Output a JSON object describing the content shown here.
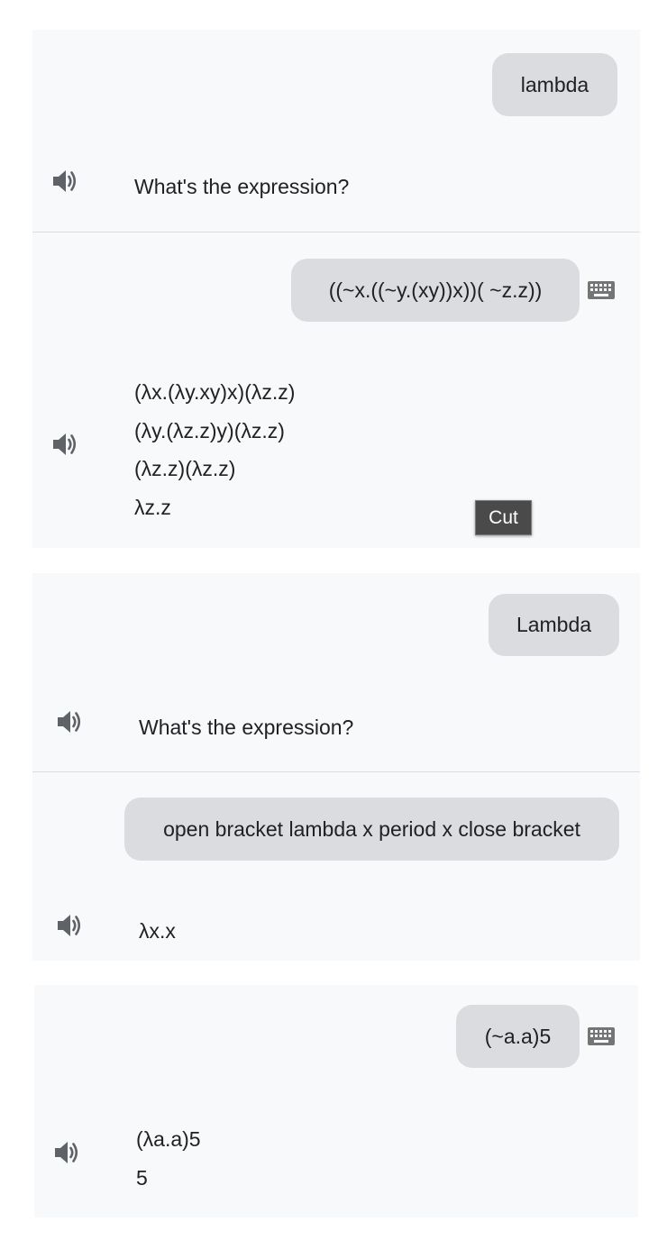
{
  "conversations": [
    {
      "turns": [
        {
          "user": "lambda",
          "reply": [
            "What's the expression?"
          ]
        },
        {
          "user": "((~x.((~y.(xy))x))( ~z.z))",
          "typed": true,
          "reply": [
            "(λx.(λy.xy)x)(λz.z)",
            "(λy.(λz.z)y)(λz.z)",
            "(λz.z)(λz.z)",
            "λz.z"
          ]
        }
      ]
    },
    {
      "turns": [
        {
          "user": "Lambda",
          "reply": [
            "What's the expression?"
          ]
        },
        {
          "user": "open bracket lambda x period x close bracket",
          "reply": [
            "λx.x"
          ]
        }
      ]
    },
    {
      "turns": [
        {
          "user": "(~a.a)5",
          "typed": true,
          "reply": [
            "(λa.a)5",
            "5"
          ]
        }
      ]
    }
  ],
  "tooltip": "Cut",
  "icons": {
    "speaker": "speaker-icon",
    "keyboard": "keyboard-icon"
  }
}
